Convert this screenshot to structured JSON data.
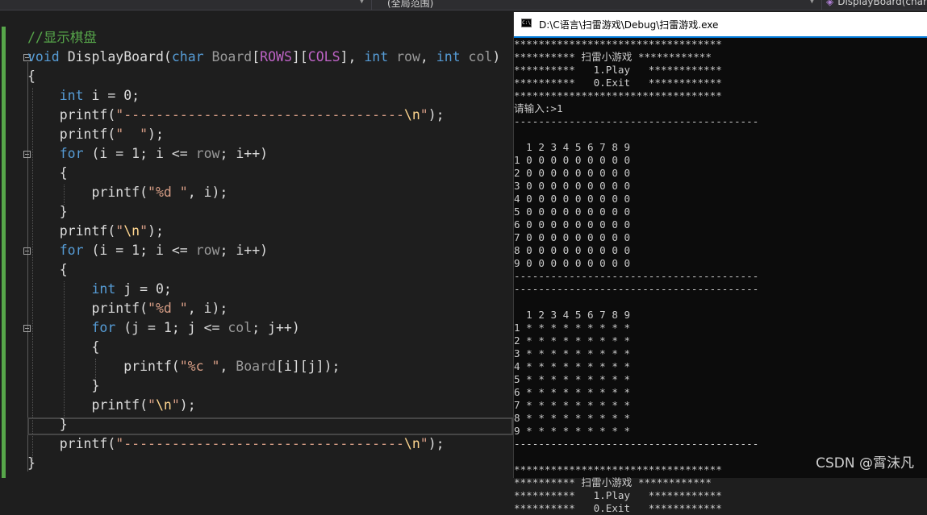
{
  "topbar": {
    "scope": "(全局范围)",
    "function": "DisplayBoard(char"
  },
  "code": [
    "//显示棋盘",
    "void DisplayBoard(char Board[ROWS][COLS], int row, int col)",
    "{",
    "    int i = 0;",
    "    printf(\"-----------------------------------\\n\");",
    "    printf(\"  \");",
    "    for (i = 1; i <= row; i++)",
    "    {",
    "        printf(\"%d \", i);",
    "    }",
    "    printf(\"\\n\");",
    "    for (i = 1; i <= row; i++)",
    "    {",
    "        int j = 0;",
    "        printf(\"%d \", i);",
    "        for (j = 1; j <= col; j++)",
    "        {",
    "            printf(\"%c \", Board[i][j]);",
    "        }",
    "        printf(\"\\n\");",
    "    }",
    "    printf(\"-----------------------------------\\n\");",
    "}"
  ],
  "console": {
    "title": "D:\\C语言\\扫雷游戏\\Debug\\扫雷游戏.exe",
    "icon": "console-app-icon",
    "lines": [
      "**********************************",
      "********** 扫雷小游戏 ************",
      "**********   1.Play   ************",
      "**********   0.Exit   ************",
      "**********************************",
      "请输入:>1",
      "----------------------------------------",
      "",
      "  1 2 3 4 5 6 7 8 9",
      "1 0 0 0 0 0 0 0 0 0",
      "2 0 0 0 0 0 0 0 0 0",
      "3 0 0 0 0 0 0 0 0 0",
      "4 0 0 0 0 0 0 0 0 0",
      "5 0 0 0 0 0 0 0 0 0",
      "6 0 0 0 0 0 0 0 0 0",
      "7 0 0 0 0 0 0 0 0 0",
      "8 0 0 0 0 0 0 0 0 0",
      "9 0 0 0 0 0 0 0 0 0",
      "----------------------------------------",
      "----------------------------------------",
      "",
      "  1 2 3 4 5 6 7 8 9",
      "1 * * * * * * * * *",
      "2 * * * * * * * * *",
      "3 * * * * * * * * *",
      "4 * * * * * * * * *",
      "5 * * * * * * * * *",
      "6 * * * * * * * * *",
      "7 * * * * * * * * *",
      "8 * * * * * * * * *",
      "9 * * * * * * * * *",
      "----------------------------------------",
      "",
      "**********************************",
      "********** 扫雷小游戏 ************",
      "**********   1.Play   ************",
      "**********   0.Exit   ************"
    ]
  },
  "watermark": "CSDN @霄沫凡",
  "colors": {
    "keyword": "#569cd6",
    "string": "#d69d85",
    "escape": "#ffd68f",
    "comment": "#57a64a",
    "macro": "#bd63c5",
    "accent": "#0078d7"
  }
}
